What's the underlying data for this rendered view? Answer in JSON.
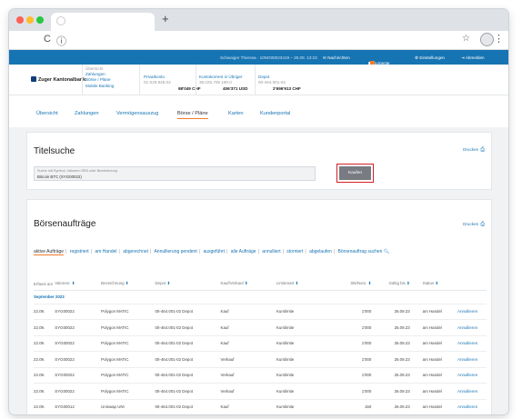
{
  "browser": {
    "new_tab": "+",
    "back": "C",
    "info": "ⓘ",
    "star": "☆",
    "menu": "⋮",
    "dot_colors": [
      "#fe5f57",
      "#febc2e",
      "#28c840"
    ]
  },
  "topbar": {
    "user": "Schwaiger Theresa · 10NO00023419 – 25.09. 13:23",
    "messages": "✉ Nachrichten",
    "documents": "Dokumente",
    "settings": "⚙ Einstellungen",
    "logout": "⇥ Abmelden"
  },
  "account": {
    "bank_name": "Zuger Kantonalbank",
    "menu": [
      "Übersicht",
      "Zahlungen",
      "Börse / Pläne",
      "Mobile Banking"
    ],
    "accounts": [
      {
        "name": "Privatkonto",
        "number": "01-029.948.03",
        "amount": "98'049 CHF"
      },
      {
        "name": "Kontokorrent in Übriger",
        "number": "39.025.709 190.0",
        "amount": "406'371 USD"
      },
      {
        "name": "Depot",
        "number": "00-464.001-02",
        "amount": "2'696'913 CHF"
      }
    ]
  },
  "subnav": [
    "Übersicht",
    "Zahlungen",
    "Vermögensauszug",
    "Börse / Pläne",
    "Karten",
    "Kundenportal"
  ],
  "title_search": {
    "title": "Titelsuche",
    "print": "Drucken",
    "placeholder": "Suche mit Symbol, Valorenr./ISIN oder Bezeichnung",
    "value": "Bitcoin BTC (SYG00022)",
    "buy_button": "Kaufen"
  },
  "orders": {
    "title": "Börsenaufträge",
    "print": "Drucken",
    "filters": [
      "aktive Aufträge",
      "registriert",
      "am Handel",
      "abgerechnet",
      "Annullierung pendent",
      "ausgeführt",
      "alle Aufträge",
      "annulliert",
      "storniert",
      "abgelaufen"
    ],
    "search_link": "Börsenauftrag suchen",
    "columns": [
      "Erfasst am",
      "Valorenr.",
      "Bezeichnung",
      "Depot",
      "Kauf/Verkauf",
      "Limitenart",
      "Stk/Nom.",
      "Gültig bis",
      "Status",
      ""
    ],
    "month": "September 2023",
    "rows": [
      {
        "date": "22.09.",
        "valor": "SYG00022",
        "name": "Polygon MATIC",
        "depot": "00-464.001-02 Depot",
        "side": "Kauf",
        "limit": "Kurslimite",
        "qty": "1'000",
        "valid": "26.09.23",
        "status": "am Handel",
        "action": "Annullieren"
      },
      {
        "date": "22.09.",
        "valor": "SYG00022",
        "name": "Polygon MATIC",
        "depot": "00-464.001-02 Depot",
        "side": "Kauf",
        "limit": "Kurslimite",
        "qty": "1'000",
        "valid": "26.09.23",
        "status": "am Handel",
        "action": "Annullieren"
      },
      {
        "date": "22.09.",
        "valor": "SYG00022",
        "name": "Polygon MATIC",
        "depot": "00-464.001-02 Depot",
        "side": "Kauf",
        "limit": "Kurslimite",
        "qty": "1'000",
        "valid": "26.09.23",
        "status": "am Handel",
        "action": "Annullieren"
      },
      {
        "date": "22.09.",
        "valor": "SYG00022",
        "name": "Polygon MATIC",
        "depot": "00-464.001-02 Depot",
        "side": "Verkauf",
        "limit": "Kurslimite",
        "qty": "1'000",
        "valid": "26.09.23",
        "status": "am Handel",
        "action": "Annullieren"
      },
      {
        "date": "22.09.",
        "valor": "SYG00022",
        "name": "Polygon MATIC",
        "depot": "00-464.001-02 Depot",
        "side": "Verkauf",
        "limit": "Kurslimite",
        "qty": "1'000",
        "valid": "26.09.23",
        "status": "am Handel",
        "action": "Annullieren"
      },
      {
        "date": "22.09.",
        "valor": "SYG00022",
        "name": "Polygon MATIC",
        "depot": "00-464.001-02 Depot",
        "side": "Verkauf",
        "limit": "Kurslimite",
        "qty": "1'000",
        "valid": "26.09.23",
        "status": "am Handel",
        "action": "Annullieren"
      },
      {
        "date": "22.09.",
        "valor": "SYG00012",
        "name": "Uniswap UNI",
        "depot": "00-464.001-02 Depot",
        "side": "Kauf",
        "limit": "Kurslimite",
        "qty": "150",
        "valid": "26.09.23",
        "status": "am Handel",
        "action": "Annullieren"
      }
    ]
  },
  "colors": {
    "brand_blue": "#1774b3",
    "accent_orange": "#f07d2e",
    "highlight_red": "#d31f25"
  }
}
